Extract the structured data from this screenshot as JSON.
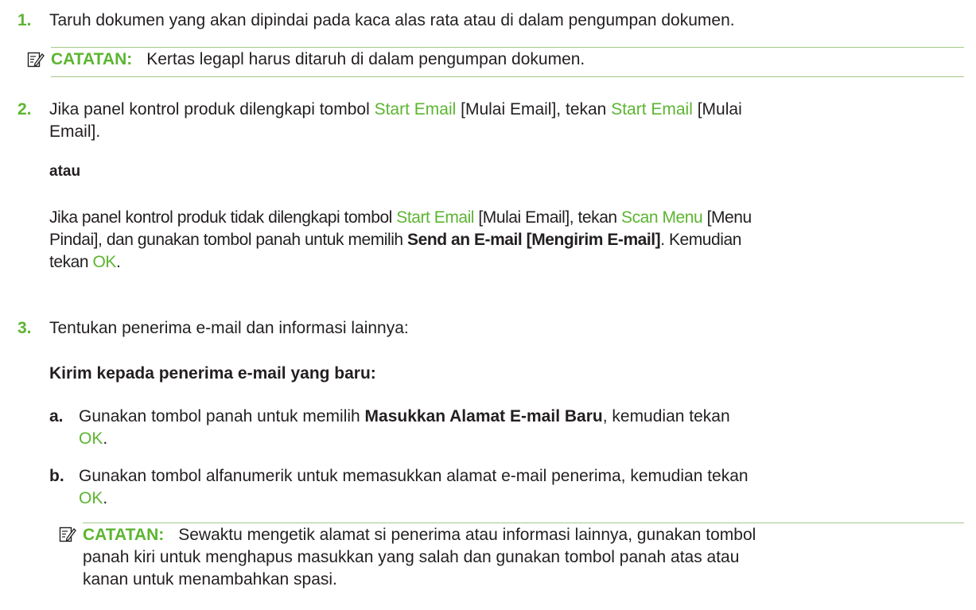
{
  "step1": {
    "number": "1.",
    "text": "Taruh dokumen yang akan dipindai pada kaca alas rata atau di dalam pengumpan dokumen."
  },
  "note1": {
    "label": "CATATAN:",
    "text": "Kertas legapl harus ditaruh di dalam pengumpan dokumen."
  },
  "step2": {
    "number": "2.",
    "p1": {
      "t1": "Jika panel kontrol produk dilengkapi tombol ",
      "link1": "Start Email",
      "t2": " [Mulai Email], tekan ",
      "link2": "Start Email",
      "t3": " [Mulai",
      "t4": "Email]."
    },
    "or_label": "atau",
    "p2": {
      "t1": "Jika panel kontrol produk tidak dilengkapi tombol ",
      "link1": "Start Email",
      "t2": " [Mulai Email], tekan ",
      "link2": "Scan Menu",
      "t3": " [Menu",
      "t4": "Pindai], dan gunakan tombol panah untuk memilih ",
      "bold": "Send an E-mail [Mengirim E-mail]",
      "t5": ". Kemudian",
      "t6": "tekan ",
      "link3": "OK",
      "t7": "."
    }
  },
  "step3": {
    "number": "3.",
    "text": "Tentukan penerima e-mail dan informasi lainnya:",
    "subheading": "Kirim kepada penerima e-mail yang baru:",
    "a": {
      "letter": "a.",
      "t1": "Gunakan tombol panah untuk memilih ",
      "bold": "Masukkan Alamat E-mail Baru",
      "t2": ", kemudian tekan",
      "link": "OK",
      "t3": "."
    },
    "b": {
      "letter": "b.",
      "t1": "Gunakan tombol alfanumerik untuk memasukkan alamat e-mail penerima, kemudian tekan",
      "link": "OK",
      "t2": "."
    }
  },
  "note2": {
    "label": "CATATAN:",
    "line1": "Sewaktu mengetik alamat si penerima atau informasi lainnya, gunakan tombol",
    "line2": "panah kiri untuk menghapus masukkan yang salah dan gunakan tombol panah atas atau",
    "line3": "kanan untuk menambahkan spasi."
  },
  "colors": {
    "accent": "#5cb531",
    "rule": "#a4c98a",
    "text": "#231f20"
  },
  "icons": {
    "note": "note-pencil-icon"
  }
}
